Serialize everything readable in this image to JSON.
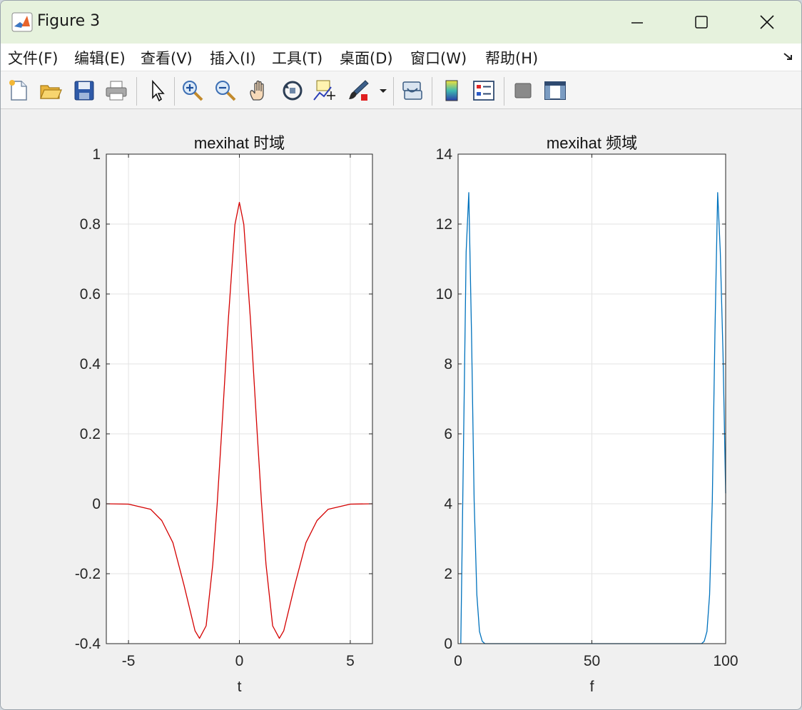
{
  "window": {
    "title": "Figure 3",
    "controls": [
      "minimize",
      "maximize",
      "close"
    ]
  },
  "menu": {
    "items": [
      "文件(F)",
      "编辑(E)",
      "查看(V)",
      "插入(I)",
      "工具(T)",
      "桌面(D)",
      "窗口(W)",
      "帮助(H)"
    ]
  },
  "toolbar": {
    "icons": [
      "new-figure-icon",
      "open-icon",
      "save-icon",
      "print-icon",
      "pointer-icon",
      "zoom-in-icon",
      "zoom-out-icon",
      "pan-hand-icon",
      "rotate-3d-icon",
      "data-cursor-icon",
      "brush-icon",
      "dropdown-arrow-icon",
      "link-plot-icon",
      "colorbar-icon",
      "legend-icon",
      "hide-plot-tools-icon",
      "show-plot-tools-icon"
    ]
  },
  "colors": {
    "time_series": "#d40000",
    "freq_series": "#0072bd",
    "grid": "#e3e3e3",
    "axes": "#262626",
    "titlebar": "#e6f2dd"
  },
  "chart_data": [
    {
      "type": "line",
      "title": "mexihat 时域",
      "xlabel": "t",
      "ylabel": "",
      "xlim": [
        -6,
        6
      ],
      "ylim": [
        -0.4,
        1
      ],
      "xticks": [
        "-5",
        "0",
        "5"
      ],
      "yticks": [
        "-0.4",
        "-0.2",
        "0",
        "0.2",
        "0.4",
        "0.6",
        "0.8",
        "1"
      ],
      "grid": true,
      "series": [
        {
          "x": [
            -6,
            -5,
            -4,
            -3.5,
            -3,
            -2.5,
            -2,
            -1.8,
            -1.5,
            -1.2,
            -1,
            -0.8,
            -0.5,
            -0.2,
            0,
            0.2,
            0.5,
            0.8,
            1,
            1.2,
            1.5,
            1.8,
            2,
            2.5,
            3,
            3.5,
            4,
            5,
            6
          ],
          "y": [
            0,
            -0.001,
            -0.016,
            -0.048,
            -0.111,
            -0.232,
            -0.363,
            -0.385,
            -0.349,
            -0.173,
            0,
            0.204,
            0.527,
            0.799,
            0.862,
            0.799,
            0.527,
            0.204,
            0,
            -0.173,
            -0.349,
            -0.385,
            -0.363,
            -0.232,
            -0.111,
            -0.048,
            -0.016,
            -0.001,
            0
          ]
        }
      ]
    },
    {
      "type": "line",
      "title": "mexihat 频域",
      "xlabel": "f",
      "ylabel": "",
      "xlim": [
        0,
        100
      ],
      "ylim": [
        0,
        14
      ],
      "xticks": [
        "0",
        "50",
        "100"
      ],
      "yticks": [
        "0",
        "2",
        "4",
        "6",
        "8",
        "10",
        "12",
        "14"
      ],
      "grid": true,
      "series": [
        {
          "x": [
            1,
            2,
            3,
            4,
            5,
            6,
            7,
            8,
            9,
            10,
            20,
            50,
            80,
            90,
            91,
            92,
            93,
            94,
            95,
            96,
            97,
            98,
            99,
            100
          ],
          "y": [
            0,
            5.5,
            11.2,
            12.9,
            8.9,
            4.1,
            1.4,
            0.35,
            0.07,
            0,
            0,
            0,
            0,
            0,
            0,
            0.07,
            0.35,
            1.4,
            4.1,
            8.9,
            12.9,
            11.2,
            8.3,
            4.3
          ]
        }
      ]
    }
  ]
}
